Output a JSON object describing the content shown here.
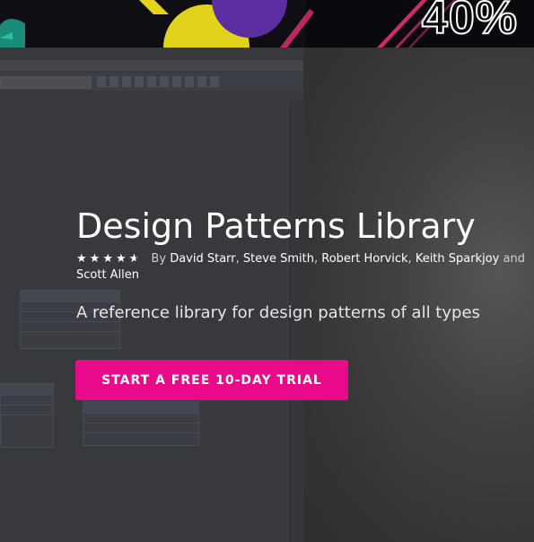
{
  "promo": {
    "discount_text": "40%"
  },
  "course": {
    "title": "Design Patterns Library",
    "rating": 4.5,
    "by_label": "By",
    "authors": [
      "David Starr",
      "Steve Smith",
      "Robert Horvick",
      "Keith Sparkjoy",
      "Scott Allen"
    ],
    "author_separator": ",",
    "and_label": "and",
    "description": "A reference library for design patterns of all types",
    "cta_label": "START A FREE 10-DAY TRIAL"
  },
  "colors": {
    "cta": "#e80a89",
    "promo_bg": "#0c0b10",
    "hero_bg": "#3d3d3d"
  },
  "icons": {
    "rating": "star-icon"
  }
}
